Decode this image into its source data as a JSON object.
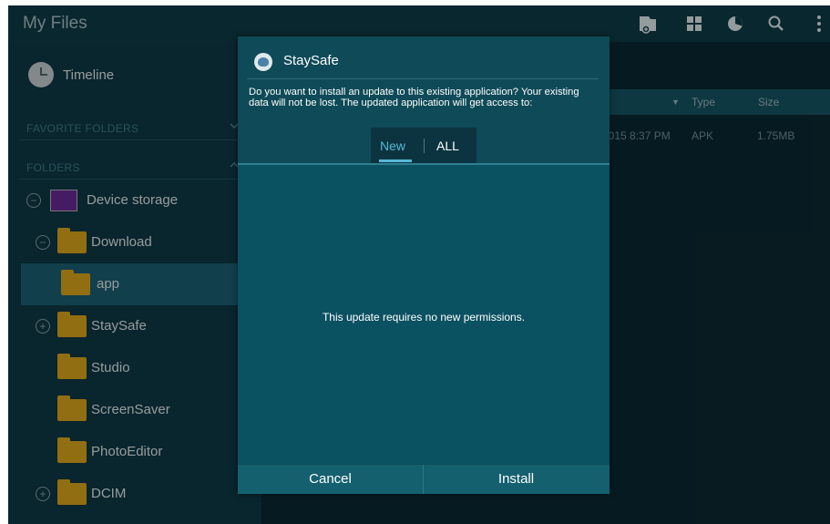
{
  "app": {
    "title": "My Files"
  },
  "toolbar": {
    "icons": [
      "add-to-folder-icon",
      "grid-view-icon",
      "storage-usage-icon",
      "search-icon",
      "overflow-menu-icon"
    ]
  },
  "sidebar": {
    "timeline_label": "Timeline",
    "favorite_folders_label": "FAVORITE FOLDERS",
    "folders_label": "FOLDERS",
    "items": [
      {
        "label": "Device storage"
      },
      {
        "label": "Download"
      },
      {
        "label": "app"
      },
      {
        "label": "StaySafe"
      },
      {
        "label": "Studio"
      },
      {
        "label": "ScreenSaver"
      },
      {
        "label": "PhotoEditor"
      },
      {
        "label": "DCIM"
      }
    ]
  },
  "list": {
    "columns": {
      "name": "",
      "type": "Type",
      "size": "Size"
    },
    "rows": [
      {
        "date": "2015 8:37 PM",
        "type": "APK",
        "size": "1.75MB"
      }
    ]
  },
  "dialog": {
    "app_name": "StaySafe",
    "message": "Do you want to install an update to this existing application? Your existing data will not be lost. The updated application will get access to:",
    "tabs": {
      "new": "New",
      "all": "ALL"
    },
    "no_permissions": "This update requires no new permissions.",
    "cancel_label": "Cancel",
    "install_label": "Install"
  },
  "colors": {
    "accent": "#58b7d6",
    "folder": "#e0a91d",
    "background": "#0a2a33"
  }
}
